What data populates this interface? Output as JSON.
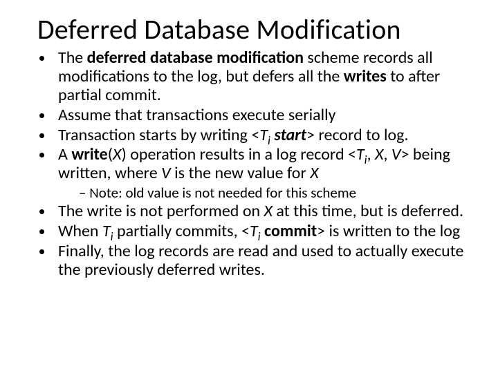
{
  "title": "Deferred Database Modification",
  "b1_a": "The ",
  "b1_bold": "deferred database modification",
  "b1_b": " scheme records all modifications to the log, but defers all the ",
  "b1_writes": "writes",
  "b1_c": " to after partial commit.",
  "b2": "Assume that transactions execute serially",
  "b3_a": "Transaction starts by writing <",
  "b3_T": "T",
  "b3_i": "i",
  "b3_sp": "  ",
  "b3_start": "start",
  "b3_b": "> record to log.",
  "b4_a": "A  ",
  "b4_write": "write",
  "b4_b": "(",
  "b4_X1": "X",
  "b4_c": ") operation results in a log record  <",
  "b4_T": "T",
  "b4_i": "i",
  "b4_d": ", ",
  "b4_X2": "X",
  "b4_e": ", ",
  "b4_V1": "V",
  "b4_f": "> being written, where ",
  "b4_V2": "V",
  "b4_g": " is the new value for ",
  "b4_X3": "X",
  "sub1": "Note: old value is not needed for this scheme",
  "b5_a": "The write is not performed on ",
  "b5_X": "X",
  "b5_b": " at this time, but is deferred.",
  "b6_a": "When ",
  "b6_T1": "T",
  "b6_i1": "i",
  "b6_b": " partially commits, ",
  "b6_lt": "<",
  "b6_T2": "T",
  "b6_i2": "i",
  "b6_sp": " ",
  "b6_commit": "commit",
  "b6_c": "> is written to the log",
  "b7": "Finally, the log records are read and used to actually execute the previously deferred writes."
}
